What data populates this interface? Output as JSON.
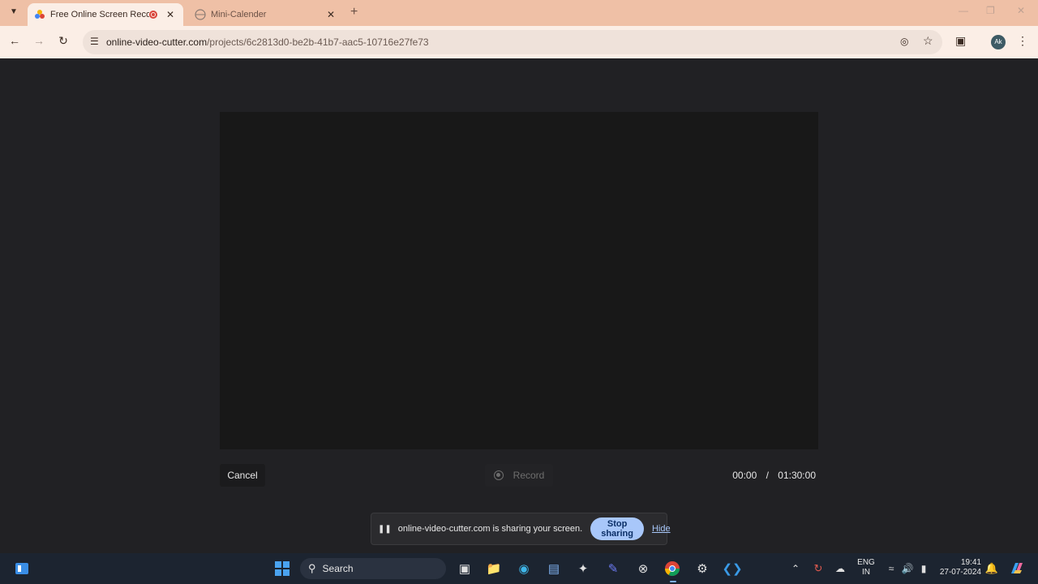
{
  "browser": {
    "tabs": [
      {
        "title": "Free Online Screen Recorde",
        "active": true
      },
      {
        "title": "Mini-Calender",
        "active": false
      }
    ],
    "url_host": "online-video-cutter.com",
    "url_path": "/projects/6c2813d0-be2b-41b7-aac5-10716e27fe73",
    "profile_initials": "Ak"
  },
  "recorder": {
    "cancel_label": "Cancel",
    "record_label": "Record",
    "elapsed": "00:00",
    "separator": "/",
    "limit": "01:30:00"
  },
  "share_bar": {
    "message": "online-video-cutter.com is sharing your screen.",
    "stop_label": "Stop sharing",
    "hide_label": "Hide"
  },
  "taskbar": {
    "search_label": "Search",
    "lang_top": "ENG",
    "lang_bottom": "IN",
    "time": "19:41",
    "date": "27-07-2024"
  },
  "icons": {
    "start": "windows-start-icon",
    "search": "search-icon",
    "accent_color": "#a8c7fa"
  }
}
